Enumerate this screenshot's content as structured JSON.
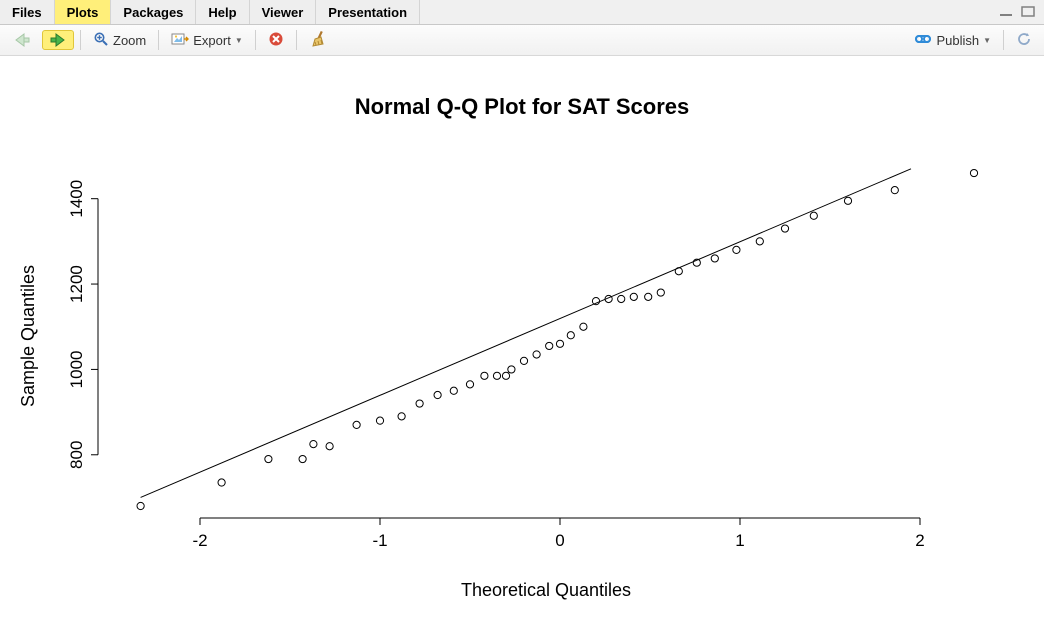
{
  "tabs": {
    "items": [
      "Files",
      "Plots",
      "Packages",
      "Help",
      "Viewer",
      "Presentation"
    ],
    "active_index": 1
  },
  "toolbar": {
    "zoom_label": "Zoom",
    "export_label": "Export",
    "publish_label": "Publish"
  },
  "chart_data": {
    "type": "scatter",
    "title": "Normal Q-Q Plot for SAT Scores",
    "xlabel": "Theoretical Quantiles",
    "ylabel": "Sample Quantiles",
    "xlim": [
      -2.5,
      2.5
    ],
    "ylim": [
      680,
      1500
    ],
    "x_ticks": [
      -2,
      -1,
      0,
      1,
      2
    ],
    "y_ticks": [
      800,
      1000,
      1200,
      1400
    ],
    "series": [
      {
        "name": "data-points",
        "x": [
          -2.33,
          -1.88,
          -1.62,
          -1.43,
          -1.37,
          -1.28,
          -1.13,
          -1.0,
          -0.88,
          -0.78,
          -0.68,
          -0.59,
          -0.5,
          -0.42,
          -0.35,
          -0.3,
          -0.27,
          -0.2,
          -0.13,
          -0.06,
          0.0,
          0.06,
          0.13,
          0.2,
          0.27,
          0.34,
          0.41,
          0.49,
          0.56,
          0.66,
          0.76,
          0.86,
          0.98,
          1.11,
          1.25,
          1.41,
          1.6,
          1.86,
          2.3
        ],
        "y": [
          680,
          735,
          790,
          790,
          825,
          820,
          870,
          880,
          890,
          920,
          940,
          950,
          965,
          985,
          985,
          985,
          1000,
          1020,
          1035,
          1055,
          1060,
          1080,
          1100,
          1160,
          1165,
          1165,
          1170,
          1170,
          1180,
          1230,
          1250,
          1260,
          1280,
          1300,
          1330,
          1360,
          1395,
          1420,
          1460
        ]
      }
    ],
    "qqline": {
      "x1": -2.33,
      "y1": 700,
      "x2": 1.95,
      "y2": 1470
    }
  }
}
